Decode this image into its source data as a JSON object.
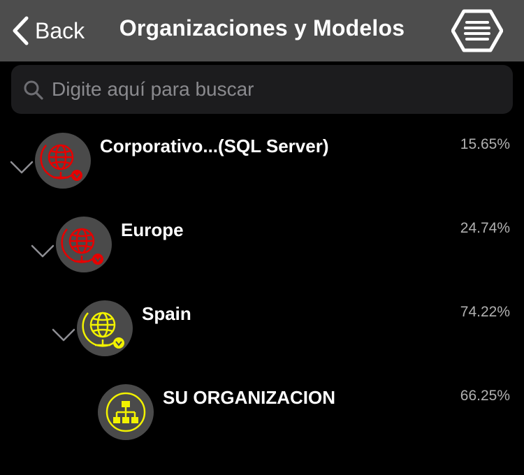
{
  "navbar": {
    "back_label": "Back",
    "title": "Organizaciones y Modelos",
    "back_icon": "chevron-left-icon",
    "menu_icon": "hexagon-menu-icon"
  },
  "search": {
    "placeholder": "Digite aquí para buscar",
    "value": "",
    "icon": "search-icon"
  },
  "tree": [
    {
      "name": "Corporativo...(SQL Server)",
      "percent": "15.65%",
      "icon": "globe-icon",
      "color": "#e60000",
      "expanded": true
    },
    {
      "name": "Europe",
      "percent": "24.74%",
      "icon": "globe-icon",
      "color": "#e60000",
      "expanded": true
    },
    {
      "name": "Spain",
      "percent": "74.22%",
      "icon": "globe-icon",
      "color": "#f2f200",
      "expanded": true
    },
    {
      "name": "SU ORGANIZACION",
      "percent": "66.25%",
      "icon": "org-chart-icon",
      "color": "#f2f200",
      "expanded": false
    }
  ],
  "colors": {
    "navbar": "#4d4d4d",
    "background": "#000000",
    "search_field": "#1c1c1e",
    "avatar": "#4a4a4a"
  }
}
